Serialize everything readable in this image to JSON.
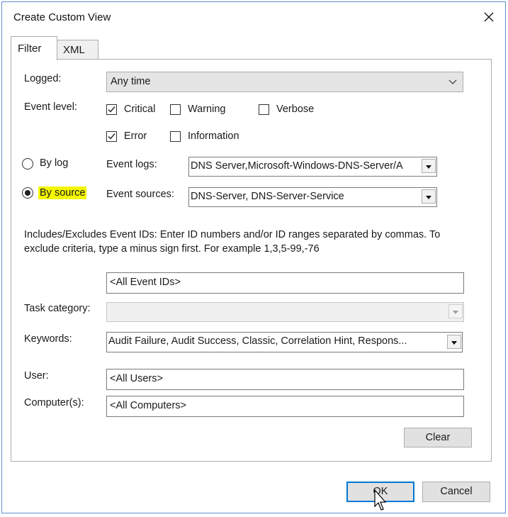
{
  "window": {
    "title": "Create Custom View"
  },
  "tabs": [
    {
      "label": "Filter"
    },
    {
      "label": "XML"
    }
  ],
  "filter": {
    "logged": {
      "label": "Logged:",
      "value": "Any time"
    },
    "event_level": {
      "label": "Event level:",
      "levels": [
        {
          "label": "Critical",
          "checked": true
        },
        {
          "label": "Warning",
          "checked": false
        },
        {
          "label": "Verbose",
          "checked": false
        },
        {
          "label": "Error",
          "checked": true
        },
        {
          "label": "Information",
          "checked": false
        }
      ]
    },
    "by_log": {
      "label": "By log",
      "selected": false,
      "field_label": "Event logs:",
      "value": "DNS Server,Microsoft-Windows-DNS-Server/A"
    },
    "by_source": {
      "label": "By source",
      "selected": true,
      "field_label": "Event sources:",
      "value": "DNS-Server, DNS-Server-Service"
    },
    "event_ids": {
      "description": "Includes/Excludes Event IDs: Enter ID numbers and/or ID ranges separated by commas. To exclude criteria, type a minus sign first. For example 1,3,5-99,-76",
      "value": "<All Event IDs>"
    },
    "task_category": {
      "label": "Task category:",
      "value": ""
    },
    "keywords": {
      "label": "Keywords:",
      "value": "Audit Failure, Audit Success, Classic, Correlation Hint, Respons..."
    },
    "user": {
      "label": "User:",
      "value": "<All Users>"
    },
    "computers": {
      "label": "Computer(s):",
      "value": "<All Computers>"
    },
    "clear_label": "Clear"
  },
  "footer": {
    "ok_label": "OK",
    "cancel_label": "Cancel"
  },
  "colors": {
    "accent": "#0078d7",
    "highlight": "#f4f600",
    "window_border": "#5a8fd0"
  }
}
